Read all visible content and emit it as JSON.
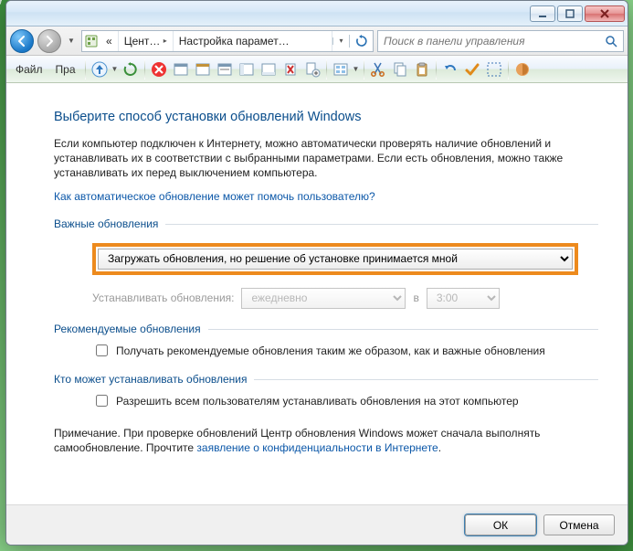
{
  "breadcrumb": {
    "seg1": "Цент…",
    "seg2": "Настройка парамет…"
  },
  "search": {
    "placeholder": "Поиск в панели управления"
  },
  "menu": {
    "file": "Файл",
    "edit": "Пра"
  },
  "heading": "Выберите способ установки обновлений Windows",
  "body": "Если компьютер подключен к Интернету, можно автоматически проверять наличие обновлений и устанавливать их в соответствии с выбранными параметрами. Если есть обновления, можно также устанавливать их перед выключением компьютера.",
  "help_link": "Как автоматическое обновление может помочь пользователю?",
  "sections": {
    "important": "Важные обновления",
    "recommended": "Рекомендуемые обновления",
    "who": "Кто может устанавливать обновления"
  },
  "important_dropdown": "Загружать обновления, но решение об установке принимается мной",
  "schedule": {
    "label": "Устанавливать обновления:",
    "freq": "ежедневно",
    "at": "в",
    "time": "3:00"
  },
  "recommended_checkbox": "Получать рекомендуемые обновления таким же образом, как и важные обновления",
  "who_checkbox": "Разрешить всем пользователям устанавливать обновления на этот компьютер",
  "note_prefix": "Примечание. При проверке обновлений Центр обновления Windows может сначала выполнять самообновление. Прочтите ",
  "note_link": "заявление о конфиденциальности в Интернете",
  "note_suffix": ".",
  "buttons": {
    "ok": "ОК",
    "cancel": "Отмена"
  }
}
